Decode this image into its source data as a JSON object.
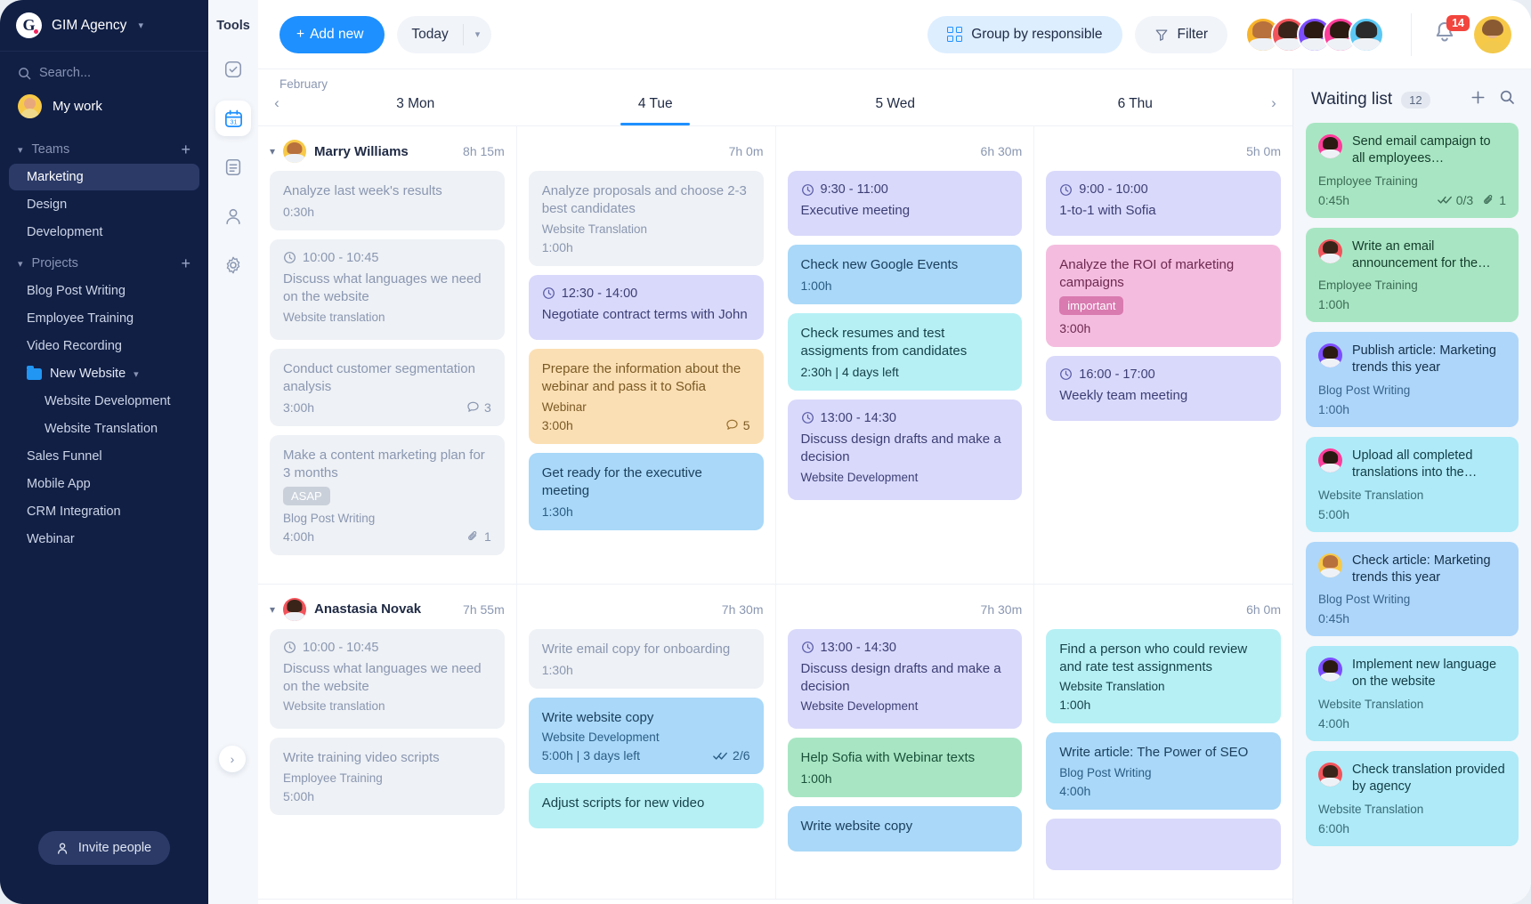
{
  "sidebar": {
    "brand": {
      "name": "GIM Agency",
      "logo_letter": "G",
      "caret": "⌄"
    },
    "search_placeholder": "Search...",
    "my_work": "My work",
    "teams_label": "Teams",
    "teams": [
      "Marketing",
      "Design",
      "Development"
    ],
    "projects_label": "Projects",
    "projects": [
      "Blog Post Writing",
      "Employee Training",
      "Video Recording"
    ],
    "folder": {
      "name": "New Website",
      "children": [
        "Website Development",
        "Website Translation"
      ]
    },
    "projects_after": [
      "Sales Funnel",
      "Mobile App",
      "CRM Integration",
      "Webinar"
    ],
    "invite_label": "Invite people"
  },
  "rail": {
    "title": "Tools"
  },
  "topbar": {
    "add_new": "Add new",
    "today": "Today",
    "group_by": "Group by responsible",
    "filter": "Filter",
    "notification_count": "14"
  },
  "calendar": {
    "month": "February",
    "days": [
      {
        "label": "3 Mon",
        "selected": false
      },
      {
        "label": "4 Tue",
        "selected": true
      },
      {
        "label": "5 Wed",
        "selected": false
      },
      {
        "label": "6 Thu",
        "selected": false
      }
    ]
  },
  "people": [
    {
      "name": "Marry Williams",
      "total": "8h 15m",
      "av_bg": "#f7c948",
      "av_hair": "#b8703c",
      "day_totals": [
        "7h 0m",
        "6h 30m",
        "5h 0m"
      ],
      "columns": [
        [
          {
            "color": "c-grey",
            "title": "Analyze last week's results",
            "duration": "0:30h"
          },
          {
            "color": "c-grey",
            "time": "10:00 - 10:45",
            "title": "Discuss what languages we need on the website",
            "project": "Website translation"
          },
          {
            "color": "c-grey",
            "title": "Conduct customer segmentation analysis",
            "duration": "3:00h",
            "comments": "3"
          },
          {
            "color": "c-grey",
            "title": "Make a content marketing plan for 3 months",
            "tag": "ASAP",
            "project": "Blog Post Writing",
            "duration": "4:00h",
            "attachments": "1"
          }
        ],
        [
          {
            "color": "c-grey",
            "title": "Analyze proposals and choose 2-3 best candidates",
            "project": "Website Translation",
            "duration": "1:00h"
          },
          {
            "color": "c-purple",
            "time": "12:30 - 14:00",
            "title": "Negotiate contract terms with John"
          },
          {
            "color": "c-orange",
            "title": "Prepare the information about the webinar and pass it to Sofia",
            "project": "Webinar",
            "duration": "3:00h",
            "comments": "5"
          },
          {
            "color": "c-blue",
            "title": "Get ready for the executive meeting",
            "duration": "1:30h"
          }
        ],
        [
          {
            "color": "c-purple",
            "time": "9:30 - 11:00",
            "title": "Executive meeting"
          },
          {
            "color": "c-blue",
            "title": "Check new Google Events",
            "duration": "1:00h"
          },
          {
            "color": "c-cyan",
            "title": "Check resumes and test assigments from candidates",
            "duration": "2:30h | 4 days left"
          },
          {
            "color": "c-purple",
            "time": "13:00 - 14:30",
            "title": "Discuss design drafts and make a decision",
            "project": "Website Development"
          }
        ],
        [
          {
            "color": "c-purple",
            "time": "9:00 - 10:00",
            "title": "1-to-1 with Sofia"
          },
          {
            "color": "c-pink",
            "title": "Analyze the ROI of marketing campaigns",
            "tag": "important",
            "duration": "3:00h"
          },
          {
            "color": "c-purple",
            "time": "16:00 - 17:00",
            "title": "Weekly team meeting"
          }
        ]
      ]
    },
    {
      "name": "Anastasia Novak",
      "total": "7h 55m",
      "av_bg": "#f2545b",
      "av_hair": "#3a2419",
      "day_totals": [
        "7h 30m",
        "7h 30m",
        "6h 0m"
      ],
      "columns": [
        [
          {
            "color": "c-grey",
            "time": "10:00 - 10:45",
            "title": "Discuss what languages we need on the website",
            "project": "Website translation"
          },
          {
            "color": "c-grey",
            "title": "Write training video scripts",
            "project": "Employee Training",
            "duration": "5:00h"
          }
        ],
        [
          {
            "color": "c-grey",
            "title": "Write email copy for onboarding",
            "duration": "1:30h"
          },
          {
            "color": "c-blue",
            "title": "Write website copy",
            "project": "Website Development",
            "duration": "5:00h | 3 days left",
            "checks": "2/6"
          },
          {
            "color": "c-cyan",
            "title": "Adjust scripts for new video"
          }
        ],
        [
          {
            "color": "c-purple",
            "time": "13:00 - 14:30",
            "title": "Discuss design drafts and make a decision",
            "project": "Website Development"
          },
          {
            "color": "c-green",
            "title": "Help Sofia with Webinar texts",
            "duration": "1:00h"
          },
          {
            "color": "c-blue",
            "title": "Write website copy"
          }
        ],
        [
          {
            "color": "c-cyan",
            "title": "Find a person who could review and rate test assignments",
            "project": "Website Translation",
            "duration": "1:00h"
          },
          {
            "color": "c-blue",
            "title": "Write article: The Power of SEO",
            "project": "Blog Post Writing",
            "duration": "4:00h"
          },
          {
            "color": "c-purple"
          }
        ]
      ]
    }
  ],
  "waiting": {
    "title": "Waiting list",
    "count": "12",
    "items": [
      {
        "color": "w-green",
        "title": "Send email campaign to all employees introducing...",
        "project": "Employee Training",
        "duration": "0:45h",
        "checks": "0/3",
        "attachments": "1",
        "av_bg": "#ff3d9a",
        "av_hair": "#2b1a12"
      },
      {
        "color": "w-green",
        "title": "Write an email announcement for the ne...",
        "project": "Employee Training",
        "duration": "1:00h",
        "av_bg": "#f2545b",
        "av_hair": "#3a2419"
      },
      {
        "color": "w-blue",
        "title": "Publish article: Marketing trends this year",
        "project": "Blog Post Writing",
        "duration": "1:00h",
        "av_bg": "#7c4dff",
        "av_hair": "#2b1a12"
      },
      {
        "color": "w-cyan",
        "title": "Upload all completed translations into the admin...",
        "project": "Website Translation",
        "duration": "5:00h",
        "av_bg": "#ff3d9a",
        "av_hair": "#2b1a12"
      },
      {
        "color": "w-blue",
        "title": "Check article: Marketing trends this year",
        "project": "Blog Post Writing",
        "duration": "0:45h",
        "av_bg": "#f7c948",
        "av_hair": "#b8703c"
      },
      {
        "color": "w-cyan",
        "title": "Implement new language on the website",
        "project": "Website Translation",
        "duration": "4:00h",
        "av_bg": "#7c4dff",
        "av_hair": "#2b1a12"
      },
      {
        "color": "w-cyan",
        "title": "Check translation provided by agency",
        "project": "Website Translation",
        "duration": "6:00h",
        "av_bg": "#f2545b",
        "av_hair": "#3a2419"
      }
    ]
  },
  "avatars": [
    {
      "bg": "#f7b32b",
      "hair": "#b8703c"
    },
    {
      "bg": "#f2545b",
      "hair": "#3a2419"
    },
    {
      "bg": "#7c4dff",
      "hair": "#2b1a12"
    },
    {
      "bg": "#ff3d9a",
      "hair": "#2b1a12"
    },
    {
      "bg": "#5bc8f5",
      "hair": "#2b2b2b"
    }
  ]
}
